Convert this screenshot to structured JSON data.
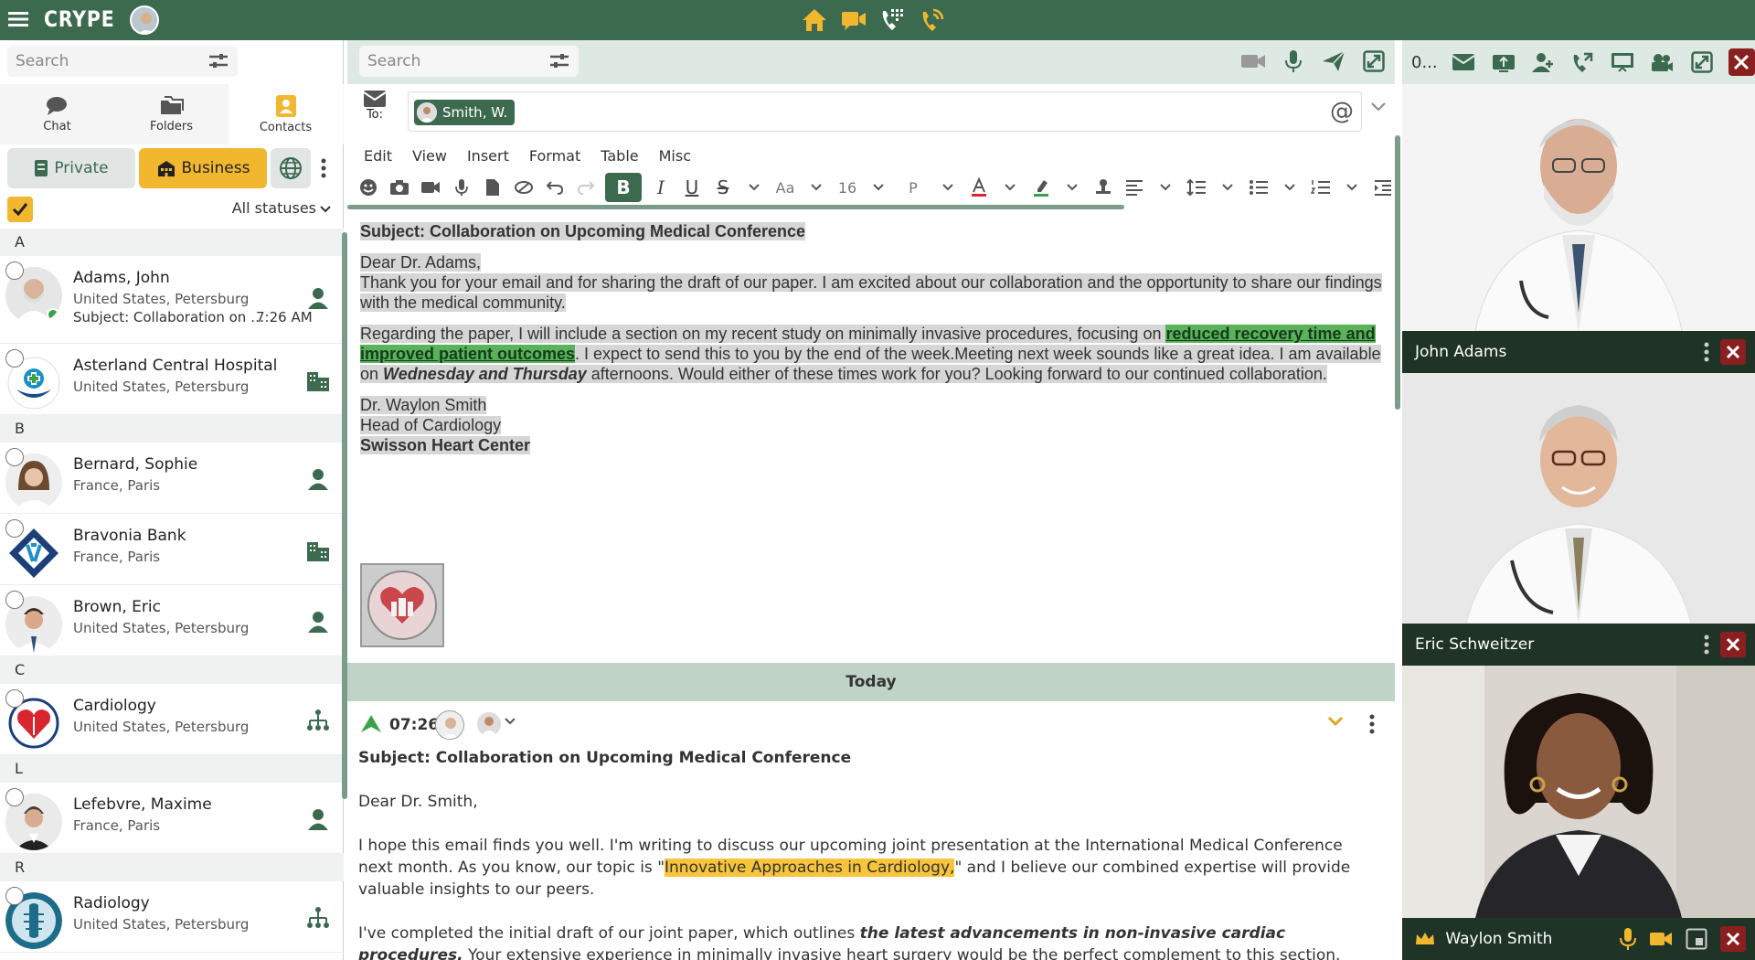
{
  "app": {
    "title": "CRYPE"
  },
  "topbar": {
    "icons": [
      "home-icon",
      "video-chat-icon",
      "dialpad-icon",
      "phone-call-icon"
    ]
  },
  "sidebar": {
    "search_placeholder": "Search",
    "tabs": [
      {
        "label": "Chat"
      },
      {
        "label": "Folders"
      },
      {
        "label": "Contacts"
      }
    ],
    "filter": {
      "private": "Private",
      "business": "Business"
    },
    "status_filter": "All statuses",
    "sections": [
      {
        "letter": "A",
        "contacts": [
          {
            "name": "Adams, John",
            "location": "United States, Petersburg",
            "subject": "Subject: Collaboration on Upcoming Medical Conference",
            "time": "7:26 AM",
            "type": "person"
          },
          {
            "name": "Asterland Central Hospital",
            "location": "United States, Petersburg",
            "type": "organization"
          }
        ]
      },
      {
        "letter": "B",
        "contacts": [
          {
            "name": "Bernard, Sophie",
            "location": "France, Paris",
            "type": "person"
          },
          {
            "name": "Bravonia Bank",
            "location": "France, Paris",
            "type": "organization"
          },
          {
            "name": "Brown, Eric",
            "location": "United States, Petersburg",
            "type": "person"
          }
        ]
      },
      {
        "letter": "C",
        "contacts": [
          {
            "name": "Cardiology",
            "location": "United States, Petersburg",
            "type": "department"
          }
        ]
      },
      {
        "letter": "L",
        "contacts": [
          {
            "name": "Lefebvre, Maxime",
            "location": "France, Paris",
            "type": "person"
          }
        ]
      },
      {
        "letter": "R",
        "contacts": [
          {
            "name": "Radiology",
            "location": "United States, Petersburg",
            "type": "department"
          }
        ]
      }
    ]
  },
  "compose": {
    "search_placeholder": "Search",
    "to_label": "To:",
    "recipient": "Smith, W.",
    "menu": [
      "Edit",
      "View",
      "Insert",
      "Format",
      "Table",
      "Misc"
    ],
    "font_size": "16",
    "font_label": "Aa",
    "paragraph_label": "P",
    "bold_label": "B",
    "italic_label": "I",
    "underline_label": "U",
    "strike_label": "S",
    "at_label": "@",
    "draft": {
      "subject": "Subject: Collaboration on Upcoming Medical Conference",
      "greeting": "Dear Dr. Adams,",
      "p1": "Thank you for your email and for sharing the draft of our paper. I am excited about our collaboration and the opportunity to share our findings with the medical community.",
      "p2_a": "Regarding the paper, I will include a section on my recent study on minimally invasive procedures, focusing on ",
      "p2_highlight": "reduced recovery time and improved patient outcomes",
      "p2_b": ". I expect to send this to you by the end of the week.Meeting next week sounds like a great idea. I am available on ",
      "p2_days": "Wednesday and Thursday",
      "p2_c": " afternoons. Would either of these times work for you? Looking forward to our continued collaboration.",
      "sig_name": "Dr. Waylon Smith",
      "sig_title": "Head of Cardiology",
      "sig_org": "Swisson Heart Center"
    }
  },
  "thread": {
    "date_label": "Today",
    "time": "07:26",
    "subject": "Subject: Collaboration on Upcoming Medical Conference",
    "greeting": "Dear Dr. Smith,",
    "p1_a": "I hope this email finds you well. I'm writing to discuss our upcoming joint presentation at the International Medical Conference next month. As you know, our topic is \"",
    "p1_highlight": "Innovative Approaches in Cardiology,",
    "p1_b": "\" and I believe our combined expertise will provide valuable insights to our peers.",
    "p2_a": "I've completed the initial draft of our joint paper, which outlines ",
    "p2_em": "the latest advancements in non-invasive cardiac procedures.",
    "p2_b": " Your extensive experience in minimally invasive heart surgery would be the perfect complement to this section. Could you provide a detailed"
  },
  "video": {
    "count": "0...",
    "participants": [
      {
        "name": "John Adams"
      },
      {
        "name": "Eric Schweitzer"
      },
      {
        "name": "Waylon Smith"
      }
    ]
  },
  "colors": {
    "brand": "#3c6a4f",
    "accent": "#f0b72f",
    "close": "#8a1f1f",
    "highlight_green": "#58b35a",
    "highlight_yellow": "#f7c43a"
  }
}
